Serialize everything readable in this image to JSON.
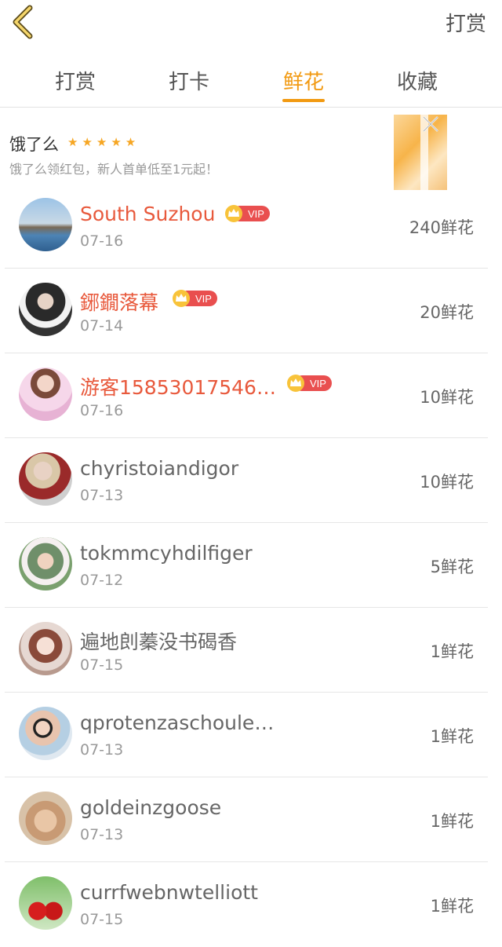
{
  "header": {
    "back_icon": "chevron-left-icon",
    "action_label": "打赏"
  },
  "tabs": [
    {
      "label": "打赏"
    },
    {
      "label": "打卡"
    },
    {
      "label": "鲜花",
      "active": true
    },
    {
      "label": "收藏"
    }
  ],
  "ad": {
    "title": "饿了么",
    "stars": "★★★★★",
    "description": "饿了么领红包，新人首单低至1元起！",
    "accent": "#f6a623"
  },
  "vip_label": "VIP",
  "list": [
    {
      "name": "South Suzhou",
      "date": "07-16",
      "amount": "240鲜花",
      "vip": true
    },
    {
      "name": "鋣鐗落幕",
      "date": "07-14",
      "amount": "20鲜花",
      "vip": true
    },
    {
      "name": "游客15853017546…",
      "date": "07-16",
      "amount": "10鲜花",
      "vip": true
    },
    {
      "name": "chyristoiandigor",
      "date": "07-13",
      "amount": "10鲜花",
      "vip": false
    },
    {
      "name": "tokmmcyhdilfiger",
      "date": "07-12",
      "amount": "5鲜花",
      "vip": false
    },
    {
      "name": "遍地剆蓁没书碣香",
      "date": "07-15",
      "amount": "1鲜花",
      "vip": false
    },
    {
      "name": "qprotenzaschoule…",
      "date": "07-13",
      "amount": "1鲜花",
      "vip": false
    },
    {
      "name": "goldeinzgoose",
      "date": "07-13",
      "amount": "1鲜花",
      "vip": false
    },
    {
      "name": "currfwebnwtelliott",
      "date": "07-15",
      "amount": "1鲜花",
      "vip": false
    }
  ],
  "colors": {
    "accent": "#f29a12",
    "vip_name": "#e8593c",
    "vip_badge": "#e94f4f",
    "text": "#666666",
    "muted": "#999999"
  }
}
